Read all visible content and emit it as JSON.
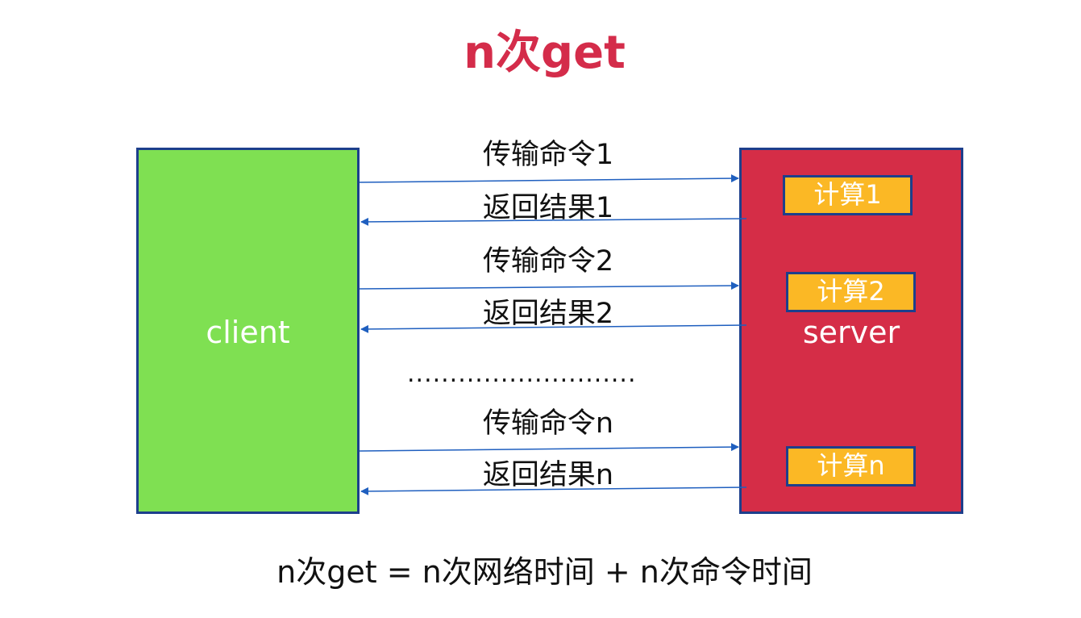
{
  "title": "n次get",
  "client": {
    "label": "client",
    "fill": "#7fe052",
    "border": "#1d3f8c"
  },
  "server": {
    "label": "server",
    "fill": "#d52d47",
    "border": "#1d3f8c"
  },
  "calculations": [
    {
      "label": "计算1"
    },
    {
      "label": "计算2"
    },
    {
      "label": "计算n"
    }
  ],
  "messages": [
    {
      "label": "传输命令1",
      "direction": "client-to-server"
    },
    {
      "label": "返回结果1",
      "direction": "server-to-client"
    },
    {
      "label": "传输命令2",
      "direction": "client-to-server"
    },
    {
      "label": "返回结果2",
      "direction": "server-to-client"
    },
    {
      "label": "传输命令n",
      "direction": "client-to-server"
    },
    {
      "label": "返回结果n",
      "direction": "server-to-client"
    }
  ],
  "ellipsis": "...........................",
  "formula": "n次get = n次网络时间 + n次命令时间",
  "colors": {
    "title": "#d42c4a",
    "arrow": "#1f5fbf",
    "calc_fill": "#fbb825"
  }
}
